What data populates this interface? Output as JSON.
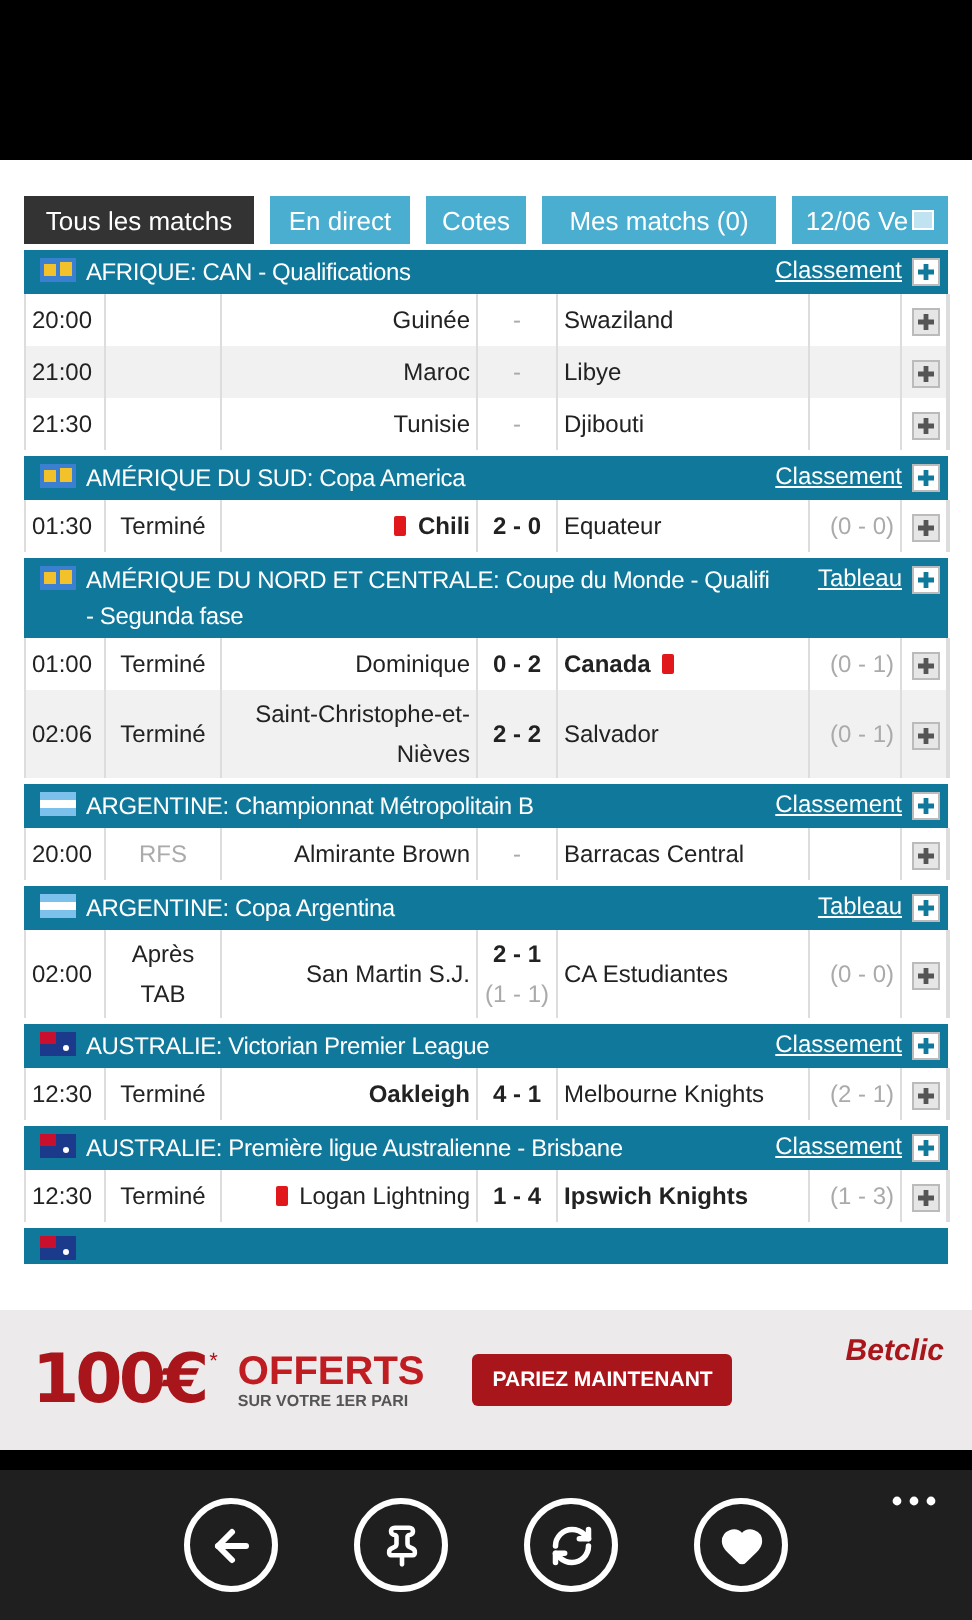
{
  "tabs": [
    {
      "label": "Tous les matchs",
      "selected": true
    },
    {
      "label": "En direct",
      "selected": false
    },
    {
      "label": "Cotes",
      "selected": false
    },
    {
      "label": "Mes matchs (0)",
      "selected": false
    },
    {
      "label": "12/06 Ve",
      "selected": false,
      "kind": "date"
    }
  ],
  "groups": [
    {
      "flag": {
        "kind": "continent"
      },
      "title": "AFRIQUE: CAN - Qualifications",
      "link": "Classement",
      "matches": [
        {
          "time": "20:00",
          "home": {
            "name": "Guinée",
            "bold": false,
            "card": false
          },
          "score": "-",
          "away": {
            "name": "Swaziland",
            "bold": false,
            "card": false
          }
        },
        {
          "time": "21:00",
          "home": {
            "name": "Maroc",
            "bold": false,
            "card": false
          },
          "score": "-",
          "away": {
            "name": "Libye",
            "bold": false,
            "card": false
          }
        },
        {
          "time": "21:30",
          "home": {
            "name": "Tunisie",
            "bold": false,
            "card": false
          },
          "score": "-",
          "away": {
            "name": "Djibouti",
            "bold": false,
            "card": false
          }
        }
      ]
    },
    {
      "flag": {
        "kind": "continent"
      },
      "title": "AMÉRIQUE DU SUD: Copa America",
      "link": "Classement",
      "matches": [
        {
          "time": "01:30",
          "status": {
            "text": "Terminé",
            "muted": false
          },
          "home": {
            "name": "Chili",
            "bold": true,
            "card": true
          },
          "score": "2 - 0",
          "away": {
            "name": "Equateur",
            "bold": false,
            "card": false
          },
          "halftime": "(0 - 0)"
        }
      ]
    },
    {
      "flag": {
        "kind": "continent"
      },
      "title": "AMÉRIQUE DU NORD ET CENTRALE: Coupe du Monde - Qualifi",
      "subtitle": "- Segunda fase",
      "link": "Tableau",
      "matches": [
        {
          "time": "01:00",
          "status": {
            "text": "Terminé",
            "muted": false
          },
          "home": {
            "name": "Dominique",
            "bold": false,
            "card": false
          },
          "score": "0 - 2",
          "away": {
            "name": "Canada",
            "bold": true,
            "card": true
          },
          "halftime": "(0 - 1)"
        },
        {
          "time": "02:06",
          "status": {
            "text": "Terminé",
            "muted": false
          },
          "home": {
            "name": "Saint-Christophe-et-Nièves",
            "bold": false,
            "card": false
          },
          "score": "2 - 2",
          "away": {
            "name": "Salvador",
            "bold": false,
            "card": false
          },
          "halftime": "(0 - 1)"
        }
      ]
    },
    {
      "flag": {
        "kind": "argentina"
      },
      "title": "ARGENTINE: Championnat Métropolitain B",
      "link": "Classement",
      "matches": [
        {
          "time": "20:00",
          "status": {
            "text": "RFS",
            "muted": true
          },
          "home": {
            "name": "Almirante Brown",
            "bold": false,
            "card": false
          },
          "score": "-",
          "away": {
            "name": "Barracas Central",
            "bold": false,
            "card": false
          }
        }
      ]
    },
    {
      "flag": {
        "kind": "argentina"
      },
      "title": "ARGENTINE: Copa Argentina",
      "link": "Tableau",
      "matches": [
        {
          "time": "02:00",
          "status": {
            "text": "Après TAB",
            "muted": false
          },
          "home": {
            "name": "San Martin S.J.",
            "bold": false,
            "card": false
          },
          "score": "2 - 1",
          "score_extra": "(1 - 1)",
          "away": {
            "name": "CA Estudiantes",
            "bold": false,
            "card": false
          },
          "halftime": "(0 - 0)"
        }
      ]
    },
    {
      "flag": {
        "kind": "australia"
      },
      "title": "AUSTRALIE: Victorian Premier League",
      "link": "Classement",
      "matches": [
        {
          "time": "12:30",
          "status": {
            "text": "Terminé",
            "muted": false
          },
          "home": {
            "name": "Oakleigh",
            "bold": true,
            "card": false
          },
          "score": "4 - 1",
          "away": {
            "name": "Melbourne Knights",
            "bold": false,
            "card": false
          },
          "halftime": "(2 - 1)"
        }
      ]
    },
    {
      "flag": {
        "kind": "australia"
      },
      "title": "AUSTRALIE: Première ligue Australienne - Brisbane",
      "link": "Classement",
      "matches": [
        {
          "time": "12:30",
          "status": {
            "text": "Terminé",
            "muted": false
          },
          "home": {
            "name": "Logan Lightning",
            "bold": false,
            "card": true
          },
          "score": "1 - 4",
          "away": {
            "name": "Ipswich Knights",
            "bold": true,
            "card": false
          },
          "halftime": "(1 - 3)"
        }
      ]
    },
    {
      "flag": {
        "kind": "australia"
      }
    }
  ],
  "ad": {
    "amount": "100€",
    "mark": "*",
    "headline": "OFFERTS",
    "subline": "SUR VOTRE 1ER PARI",
    "button": "PARIEZ MAINTENANT",
    "brand": "Betclic"
  },
  "appbar": [
    {
      "kind": "back"
    },
    {
      "kind": "pin"
    },
    {
      "kind": "refresh"
    },
    {
      "kind": "favorite"
    }
  ]
}
